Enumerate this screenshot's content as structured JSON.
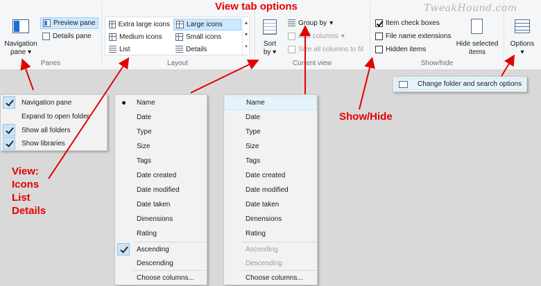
{
  "title": "View tab options",
  "watermark": "TweakHound.com",
  "ribbon": {
    "panes": {
      "navigation_pane_line1": "Navigation",
      "navigation_pane_line2": "pane",
      "preview_pane": "Preview pane",
      "details_pane": "Details pane",
      "group_label": "Panes"
    },
    "layout": {
      "items": [
        "Extra large icons",
        "Large icons",
        "Medium icons",
        "Small icons",
        "List",
        "Details"
      ],
      "selected": "Large icons",
      "group_label": "Layout"
    },
    "current_view": {
      "sort_by_line1": "Sort",
      "sort_by_line2": "by",
      "group_by": "Group by",
      "add_columns": "Add columns",
      "size_all_columns": "Size all columns to fit",
      "group_label": "Current view"
    },
    "show_hide": {
      "item_check_boxes": "Item check boxes",
      "file_name_extensions": "File name extensions",
      "hidden_items": "Hidden items",
      "hide_selected_line1": "Hide selected",
      "hide_selected_line2": "items",
      "group_label": "Show/hide"
    },
    "options": {
      "label": "Options",
      "change_folder": "Change folder and search options"
    }
  },
  "nav_menu": {
    "items": [
      {
        "label": "Navigation pane",
        "checked": true
      },
      {
        "label": "Expand to open folder",
        "checked": false
      },
      {
        "label": "Show all folders",
        "checked": true
      },
      {
        "label": "Show libraries",
        "checked": true
      }
    ]
  },
  "sort_menu": {
    "items": [
      "Name",
      "Date",
      "Type",
      "Size",
      "Tags",
      "Date created",
      "Date modified",
      "Date taken",
      "Dimensions",
      "Rating"
    ],
    "ascending": "Ascending",
    "descending": "Descending",
    "choose_columns": "Choose columns..."
  },
  "group_menu": {
    "items": [
      "Name",
      "Date",
      "Type",
      "Size",
      "Tags",
      "Date created",
      "Date modified",
      "Date taken",
      "Dimensions",
      "Rating"
    ],
    "ascending": "Ascending",
    "descending": "Descending",
    "choose_columns": "Choose columns..."
  },
  "callouts": {
    "view_line1": "View:",
    "view_line2": "Icons",
    "view_line3": "List",
    "view_line4": "Details",
    "show_hide": "Show/Hide"
  },
  "colors": {
    "callout": "#e30000",
    "selection": "#cde8ff",
    "background": "#d9d9d9"
  }
}
